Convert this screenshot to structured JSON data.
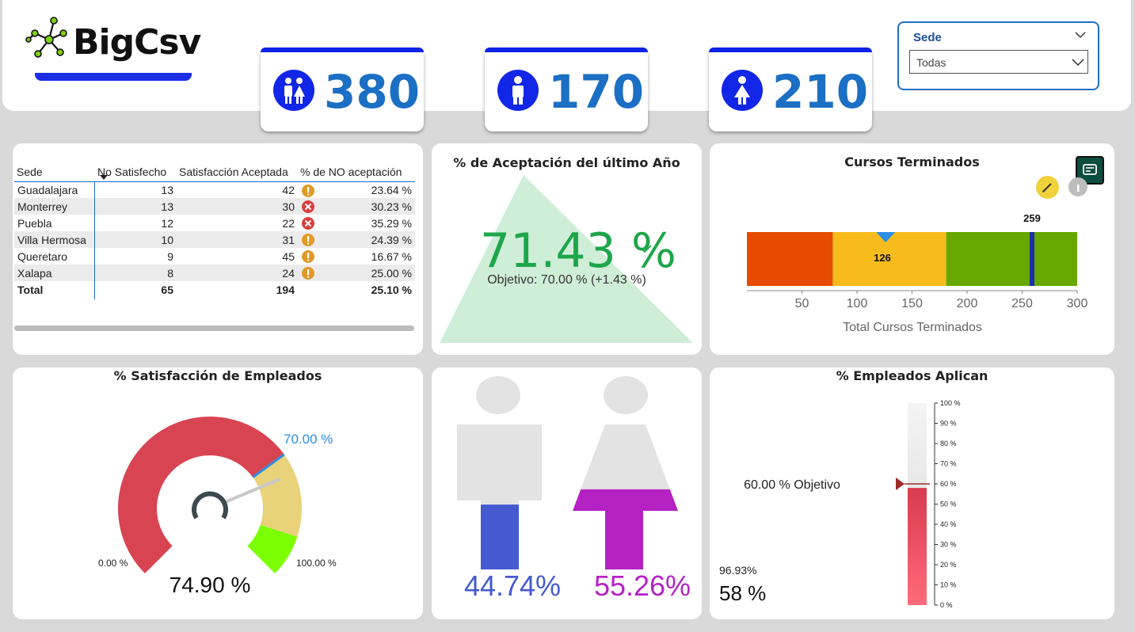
{
  "brand": {
    "logo_text": "BigCsv",
    "accent": "#1226e8"
  },
  "kpis": [
    {
      "icon": "people-icon",
      "value": "380"
    },
    {
      "icon": "male-icon",
      "value": "170"
    },
    {
      "icon": "female-icon",
      "value": "210"
    }
  ],
  "slicer": {
    "title": "Sede",
    "selected": "Todas"
  },
  "table": {
    "headers": [
      "Sede",
      "No Satisfecho",
      "Satisfacción Aceptada",
      "% de NO aceptación"
    ],
    "rows": [
      {
        "sede": "Guadalajara",
        "no_sat": "13",
        "sat": "42",
        "status": "warning",
        "pct": "23.64 %"
      },
      {
        "sede": "Monterrey",
        "no_sat": "13",
        "sat": "30",
        "status": "error",
        "pct": "30.23 %"
      },
      {
        "sede": "Puebla",
        "no_sat": "12",
        "sat": "22",
        "status": "error",
        "pct": "35.29 %"
      },
      {
        "sede": "Villa Hermosa",
        "no_sat": "10",
        "sat": "31",
        "status": "warning",
        "pct": "24.39 %"
      },
      {
        "sede": "Queretaro",
        "no_sat": "9",
        "sat": "45",
        "status": "warning",
        "pct": "16.67 %"
      },
      {
        "sede": "Xalapa",
        "no_sat": "8",
        "sat": "24",
        "status": "warning",
        "pct": "25.00 %"
      }
    ],
    "total": {
      "label": "Total",
      "no_sat": "65",
      "sat": "194",
      "pct": "25.10 %"
    }
  },
  "acceptance": {
    "title": "% de Aceptación del último Año",
    "value": "71.43 %",
    "goal_text": "Objetivo: 70.00 % (+1.43 %)"
  },
  "courses": {
    "title": "Cursos Terminados",
    "axis_title": "Total Cursos Terminados",
    "value_label": "126",
    "target_label": "259",
    "ticks": [
      "50",
      "100",
      "150",
      "200",
      "250",
      "300"
    ]
  },
  "satisfaction": {
    "title": "% Satisfacción de Empleados",
    "value": "74.90 %",
    "target_label": "70.00 %",
    "min_label": "0.00 %",
    "max_label": "100.00 %"
  },
  "gender": {
    "male_pct": "44.74%",
    "female_pct": "55.26%"
  },
  "apply": {
    "title": "% Empleados Aplican",
    "target_label": "60.00 % Objetivo",
    "small_value": "96.93%",
    "value": "58 %",
    "ticks": [
      "100 %",
      "90 %",
      "80 %",
      "70 %",
      "60 %",
      "50 %",
      "40 %",
      "30 %",
      "20 %",
      "10 %",
      "0 %"
    ]
  },
  "chart_data": [
    {
      "type": "table",
      "title": "",
      "columns": [
        "Sede",
        "No Satisfecho",
        "Satisfacción Aceptada",
        "% de NO aceptación"
      ],
      "rows": [
        [
          "Guadalajara",
          13,
          42,
          23.64
        ],
        [
          "Monterrey",
          13,
          30,
          30.23
        ],
        [
          "Puebla",
          12,
          22,
          35.29
        ],
        [
          "Villa Hermosa",
          10,
          31,
          24.39
        ],
        [
          "Queretaro",
          9,
          45,
          16.67
        ],
        [
          "Xalapa",
          8,
          24,
          25.0
        ]
      ]
    },
    {
      "type": "bar",
      "title": "Cursos Terminados",
      "xlabel": "Total Cursos Terminados",
      "xlim": [
        0,
        300
      ],
      "bands": [
        {
          "from": 0,
          "to": 78,
          "color": "#e64b00"
        },
        {
          "from": 78,
          "to": 181,
          "color": "#f7bc1c"
        },
        {
          "from": 181,
          "to": 300,
          "color": "#66a800"
        }
      ],
      "value": 126,
      "target": 259
    },
    {
      "type": "bar",
      "title": "% Satisfacción de Empleados",
      "min": 0,
      "max": 100,
      "value": 74.9,
      "target": 70,
      "bands": [
        {
          "from": 0,
          "to": 70,
          "color": "#d94452"
        },
        {
          "from": 70,
          "to": 90,
          "color": "#e8d27a"
        },
        {
          "from": 90,
          "to": 100,
          "color": "#7cff00"
        }
      ]
    },
    {
      "type": "bar",
      "title": "% Empleados Aplican",
      "ylim": [
        0,
        100
      ],
      "value": 58,
      "target": 60
    }
  ]
}
